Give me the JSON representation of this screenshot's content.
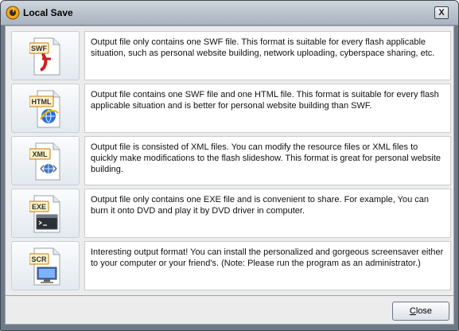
{
  "window": {
    "title": "Local Save",
    "close_glyph": "X",
    "app_icon": "local-save-app-icon"
  },
  "formats": [
    {
      "id": "swf",
      "badge": "SWF",
      "icon": "swf-file-icon",
      "description": "Output file only contains one SWF file. This format is suitable for every flash applicable situation, such as personal website building, network uploading, cyberspace sharing, etc."
    },
    {
      "id": "html",
      "badge": "HTML",
      "icon": "html-file-icon",
      "description": "Output file contains one SWF file and one HTML file. This format is suitable for every flash applicable situation and is better for personal website building than SWF."
    },
    {
      "id": "xml",
      "badge": "XML",
      "icon": "xml-file-icon",
      "description": "Output file is consisted of XML files. You can modify the resource files or XML files to quickly make modifications to the flash slideshow. This format is great for personal website building."
    },
    {
      "id": "exe",
      "badge": "EXE",
      "icon": "exe-file-icon",
      "description": "Output file only contains one EXE file and is convenient to share. For example, You can burn it onto DVD and play it by DVD driver in computer."
    },
    {
      "id": "scr",
      "badge": "SCR",
      "icon": "scr-file-icon",
      "description": "Interesting output format! You can install the personalized and gorgeous screensaver either to your computer or your friend's. (Note: Please run the program as an administrator.)"
    }
  ],
  "footer": {
    "close_label_mnemonic": "C",
    "close_label_rest": "lose"
  },
  "colors": {
    "badge_border": "#c77a10",
    "badge_fill": "#fff2c8",
    "swf_red": "#d21d1d",
    "html_blue": "#2a6fd6",
    "xml_blue": "#3e78c8"
  }
}
